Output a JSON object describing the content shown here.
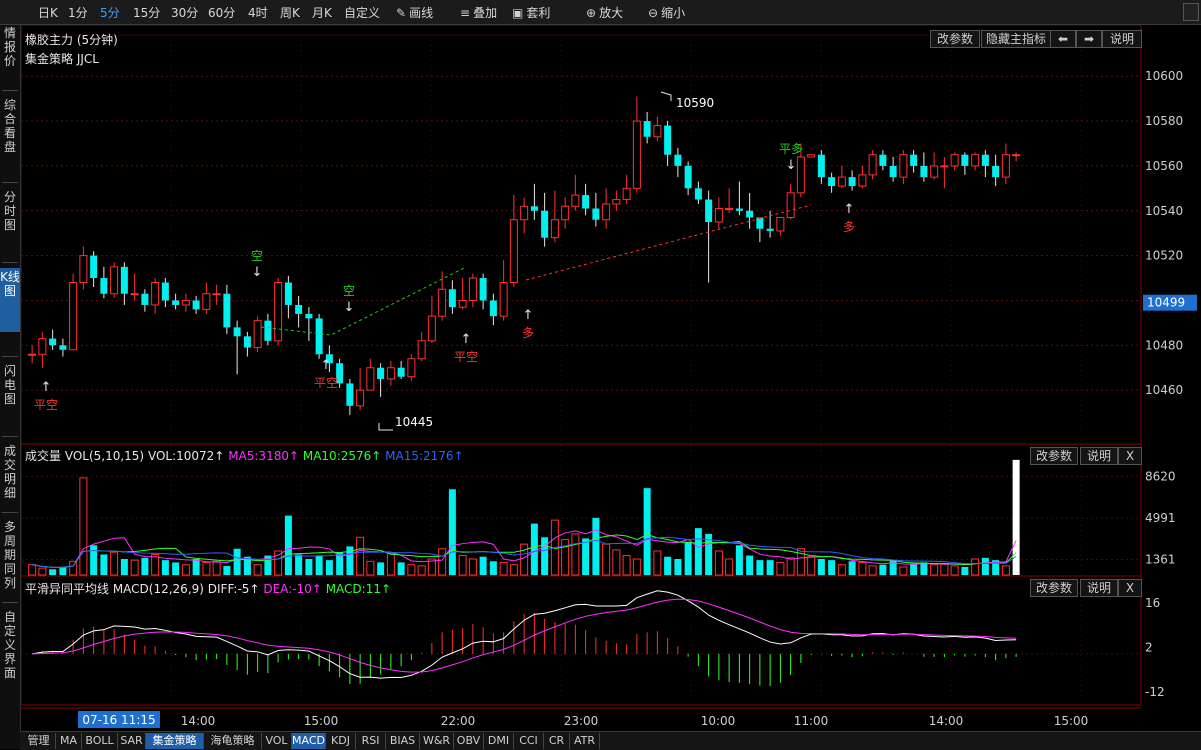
{
  "toolbar": {
    "periods": [
      "日K",
      "1分",
      "5分",
      "15分",
      "30分",
      "60分",
      "4时",
      "周K",
      "月K",
      "自定义"
    ],
    "active_period": "5分",
    "tools": [
      {
        "icon": "pencil-icon",
        "label": "画线"
      },
      {
        "icon": "stack-icon",
        "label": "叠加"
      },
      {
        "icon": "arbitrage-icon",
        "label": "套利"
      },
      {
        "icon": "zoom-in-icon",
        "label": "放大"
      },
      {
        "icon": "zoom-out-icon",
        "label": "缩小"
      }
    ]
  },
  "sidebar": {
    "items": [
      {
        "label": "行情报价",
        "active": false
      },
      {
        "label": "综合看盘",
        "active": false
      },
      {
        "label": "分时图",
        "active": false
      },
      {
        "label": "K线图",
        "active": true
      },
      {
        "label": "闪电图",
        "active": false
      },
      {
        "label": "成交明细",
        "active": false
      },
      {
        "label": "多周期同列",
        "active": false
      },
      {
        "label": "自定义界面",
        "active": false
      }
    ]
  },
  "main_panel": {
    "title": "橡胶主力 (5分钟)",
    "strategy_label": "集金策略 JJCL",
    "buttons": [
      "改参数",
      "隐藏主指标",
      "⬅",
      "➡",
      "说明"
    ],
    "price_axis": [
      "10600",
      "10580",
      "10560",
      "10540",
      "10520",
      "10500",
      "10480",
      "10460"
    ],
    "current_price": "10499",
    "high_mark": "10590",
    "low_mark": "10445",
    "signals": [
      {
        "text": "平空",
        "color": "#ff3030"
      },
      {
        "text": "空",
        "color": "#22cc22"
      },
      {
        "text": "平空",
        "color": "#ff3030"
      },
      {
        "text": "空",
        "color": "#22cc22"
      },
      {
        "text": "平空",
        "color": "#ff3030"
      },
      {
        "text": "多",
        "color": "#ff3030"
      },
      {
        "text": "平多",
        "color": "#22cc22"
      },
      {
        "text": "多",
        "color": "#ff3030"
      }
    ]
  },
  "volume_panel": {
    "title": "成交量 VOL(5,10,15)",
    "vol": "VOL:10072↑",
    "ma5": "MA5:3180↑",
    "ma10": "MA10:2576↑",
    "ma15": "MA15:2176↑",
    "buttons": [
      "改参数",
      "说明",
      "X"
    ],
    "axis": [
      "8620",
      "4991",
      "1361"
    ],
    "colors": {
      "ma5": "#ff30ff",
      "ma10": "#30ff30",
      "ma15": "#3060ff"
    }
  },
  "macd_panel": {
    "title": "平滑异同平均线 MACD(12,26,9)",
    "diff": "DIFF:-5↑",
    "dea": "DEA:-10↑",
    "macd": "MACD:11↑",
    "buttons": [
      "改参数",
      "说明",
      "X"
    ],
    "axis": [
      "16",
      "2",
      "-12"
    ]
  },
  "time_axis": {
    "cursor_label": "07-16 11:15",
    "labels": [
      "14:00",
      "15:00",
      "22:00",
      "23:00",
      "10:00",
      "11:00",
      "14:00",
      "15:00"
    ]
  },
  "bottom_tabs": {
    "items": [
      "管理",
      "MA",
      "BOLL",
      "SAR",
      "集金策略",
      "海龟策略",
      "VOL",
      "MACD",
      "KDJ",
      "RSI",
      "BIAS",
      "W&R",
      "OBV",
      "DMI",
      "CCI",
      "CR",
      "ATR"
    ],
    "active": [
      "集金策略",
      "MACD"
    ]
  },
  "chart_data": {
    "type": "candlestick",
    "title": "橡胶主力 (5分钟)",
    "ylim": [
      10440,
      10605
    ],
    "up_color": "#ff3030",
    "down_color": "#00f0f0",
    "candles": [
      [
        10476,
        10476,
        10480,
        10472
      ],
      [
        10476,
        10483,
        10486,
        10470
      ],
      [
        10483,
        10480,
        10487,
        10478
      ],
      [
        10480,
        10478,
        10483,
        10475
      ],
      [
        10478,
        10508,
        10512,
        10478
      ],
      [
        10508,
        10520,
        10524,
        10505
      ],
      [
        10520,
        10510,
        10522,
        10506
      ],
      [
        10510,
        10503,
        10515,
        10501
      ],
      [
        10503,
        10515,
        10517,
        10501
      ],
      [
        10515,
        10503,
        10517,
        10498
      ],
      [
        10503,
        10503,
        10512,
        10500
      ],
      [
        10503,
        10498,
        10505,
        10495
      ],
      [
        10498,
        10508,
        10510,
        10494
      ],
      [
        10508,
        10500,
        10510,
        10497
      ],
      [
        10500,
        10498,
        10503,
        10496
      ],
      [
        10498,
        10500,
        10503,
        10495
      ],
      [
        10500,
        10496,
        10502,
        10494
      ],
      [
        10496,
        10503,
        10508,
        10494
      ],
      [
        10503,
        10503,
        10507,
        10498
      ],
      [
        10503,
        10488,
        10507,
        10485
      ],
      [
        10488,
        10484,
        10491,
        10467
      ],
      [
        10484,
        10479,
        10486,
        10475
      ],
      [
        10479,
        10491,
        10493,
        10477
      ],
      [
        10491,
        10482,
        10494,
        10480
      ],
      [
        10482,
        10508,
        10510,
        10480
      ],
      [
        10508,
        10498,
        10511,
        10492
      ],
      [
        10498,
        10494,
        10502,
        10488
      ],
      [
        10494,
        10492,
        10497,
        10482
      ],
      [
        10492,
        10476,
        10494,
        10474
      ],
      [
        10476,
        10472,
        10480,
        10468
      ],
      [
        10472,
        10463,
        10474,
        10461
      ],
      [
        10463,
        10453,
        10465,
        10449
      ],
      [
        10453,
        10460,
        10470,
        10451
      ],
      [
        10460,
        10470,
        10474,
        10462
      ],
      [
        10470,
        10465,
        10472,
        10457
      ],
      [
        10465,
        10470,
        10473,
        10462
      ],
      [
        10470,
        10466,
        10473,
        10465
      ],
      [
        10466,
        10474,
        10476,
        10464
      ],
      [
        10474,
        10482,
        10486,
        10473
      ],
      [
        10482,
        10493,
        10502,
        10481
      ],
      [
        10493,
        10505,
        10513,
        10491
      ],
      [
        10505,
        10497,
        10509,
        10494
      ],
      [
        10497,
        10500,
        10510,
        10496
      ],
      [
        10500,
        10510,
        10512,
        10497
      ],
      [
        10510,
        10500,
        10512,
        10496
      ],
      [
        10500,
        10493,
        10503,
        10489
      ],
      [
        10493,
        10508,
        10518,
        10491
      ],
      [
        10508,
        10536,
        10547,
        10506
      ],
      [
        10536,
        10542,
        10546,
        10530
      ],
      [
        10542,
        10540,
        10552,
        10536
      ],
      [
        10540,
        10528,
        10548,
        10524
      ],
      [
        10528,
        10536,
        10549,
        10526
      ],
      [
        10536,
        10542,
        10546,
        10532
      ],
      [
        10542,
        10547,
        10556,
        10540
      ],
      [
        10547,
        10541,
        10552,
        10538
      ],
      [
        10541,
        10536,
        10548,
        10533
      ],
      [
        10536,
        10543,
        10550,
        10532
      ],
      [
        10543,
        10545,
        10549,
        10540
      ],
      [
        10545,
        10550,
        10556,
        10543
      ],
      [
        10550,
        10580,
        10591,
        10548
      ],
      [
        10580,
        10573,
        10584,
        10570
      ],
      [
        10573,
        10578,
        10582,
        10571
      ],
      [
        10578,
        10565,
        10580,
        10560
      ],
      [
        10565,
        10560,
        10568,
        10555
      ],
      [
        10560,
        10550,
        10562,
        10547
      ],
      [
        10550,
        10545,
        10553,
        10543
      ],
      [
        10545,
        10535,
        10549,
        10508
      ],
      [
        10535,
        10541,
        10546,
        10532
      ],
      [
        10541,
        10541,
        10550,
        10539
      ],
      [
        10541,
        10540,
        10553,
        10538
      ],
      [
        10540,
        10537,
        10548,
        10532
      ],
      [
        10537,
        10532,
        10537,
        10526
      ],
      [
        10532,
        10531,
        10540,
        10528
      ],
      [
        10531,
        10537,
        10537,
        10529
      ],
      [
        10537,
        10548,
        10552,
        10536
      ],
      [
        10548,
        10564,
        10570,
        10546
      ],
      [
        10564,
        10565,
        10565,
        10565
      ],
      [
        10565,
        10555,
        10567,
        10552
      ],
      [
        10555,
        10551,
        10557,
        10548
      ],
      [
        10551,
        10555,
        10560,
        10550
      ],
      [
        10555,
        10551,
        10558,
        10549
      ],
      [
        10551,
        10556,
        10560,
        10550
      ],
      [
        10556,
        10565,
        10567,
        10554
      ],
      [
        10565,
        10560,
        10567,
        10558
      ],
      [
        10560,
        10555,
        10564,
        10553
      ],
      [
        10555,
        10565,
        10567,
        10552
      ],
      [
        10565,
        10560,
        10567,
        10557
      ],
      [
        10560,
        10555,
        10566,
        10553
      ],
      [
        10555,
        10560,
        10566,
        10554
      ],
      [
        10560,
        10560,
        10564,
        10550
      ],
      [
        10560,
        10565,
        10566,
        10558
      ],
      [
        10565,
        10560,
        10566,
        10556
      ],
      [
        10560,
        10565,
        10566,
        10558
      ],
      [
        10565,
        10560,
        10567,
        10555
      ],
      [
        10560,
        10555,
        10565,
        10551
      ],
      [
        10555,
        10565,
        10570,
        10552
      ],
      [
        10565,
        10565,
        10566,
        10562
      ]
    ],
    "volume": [
      900,
      600,
      500,
      700,
      1200,
      8500,
      2600,
      1800,
      2000,
      1400,
      1300,
      1500,
      1800,
      1300,
      1100,
      900,
      1400,
      1100,
      1200,
      800,
      2300,
      1600,
      900,
      1700,
      2100,
      5200,
      1800,
      1400,
      1700,
      1300,
      2000,
      2500,
      3300,
      1200,
      1100,
      1900,
      1100,
      900,
      800,
      1400,
      2300,
      7500,
      1700,
      1400,
      1600,
      1200,
      1100,
      900,
      2700,
      4500,
      3300,
      4800,
      3100,
      3600,
      3200,
      5000,
      2700,
      2200,
      1700,
      1400,
      7600,
      2100,
      1600,
      1400,
      2900,
      4100,
      3600,
      2100,
      1400,
      2600,
      1700,
      1300,
      1300,
      1100,
      1500,
      2300,
      1600,
      1400,
      1300,
      900,
      1200,
      1100,
      800,
      900,
      1300,
      700,
      1000,
      1100,
      900,
      1000,
      800,
      700,
      1400,
      1500,
      1300,
      800,
      10072
    ],
    "macd": {
      "diff": -5,
      "dea": -10,
      "macd": 11,
      "ylim": [
        -16,
        20
      ]
    }
  }
}
